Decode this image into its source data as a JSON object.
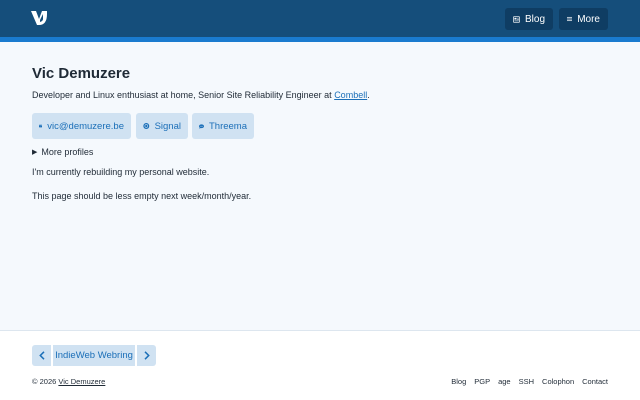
{
  "header": {
    "logo_icon": "vd-logo-icon",
    "nav": [
      {
        "label": "Blog",
        "icon": "newspaper-icon"
      },
      {
        "label": "More",
        "icon": "hamburger-icon"
      }
    ]
  },
  "main": {
    "title": "Vic Demuzere",
    "intro_text": "Developer and Linux enthusiast at home, Senior Site Reliability Engineer at ",
    "intro_link": "Combell",
    "intro_end": ".",
    "contacts": [
      {
        "label": "vic@demuzere.be",
        "icon": "envelope-icon"
      },
      {
        "label": "Signal",
        "icon": "signal-icon"
      },
      {
        "label": "Threema",
        "icon": "chat-bubble-icon"
      }
    ],
    "more_profiles": "More profiles",
    "paragraphs": [
      "I'm currently rebuilding my personal website.",
      "This page should be less empty next week/month/year."
    ]
  },
  "footer": {
    "webring": {
      "label": "IndieWeb Webring",
      "prev_icon": "chevron-left-icon",
      "next_icon": "chevron-right-icon"
    },
    "copyright_prefix": "© 2026 ",
    "copyright_name": "Vic Demuzere",
    "links": [
      "Blog",
      "PGP",
      "age",
      "SSH",
      "Colophon",
      "Contact"
    ]
  },
  "colors": {
    "header_bg": "#154e7b",
    "accent_stripe": "#1a7bcf",
    "pill_bg": "#d0e2f2",
    "link": "#1b6fb8",
    "page_bg": "#f5f9fd"
  }
}
